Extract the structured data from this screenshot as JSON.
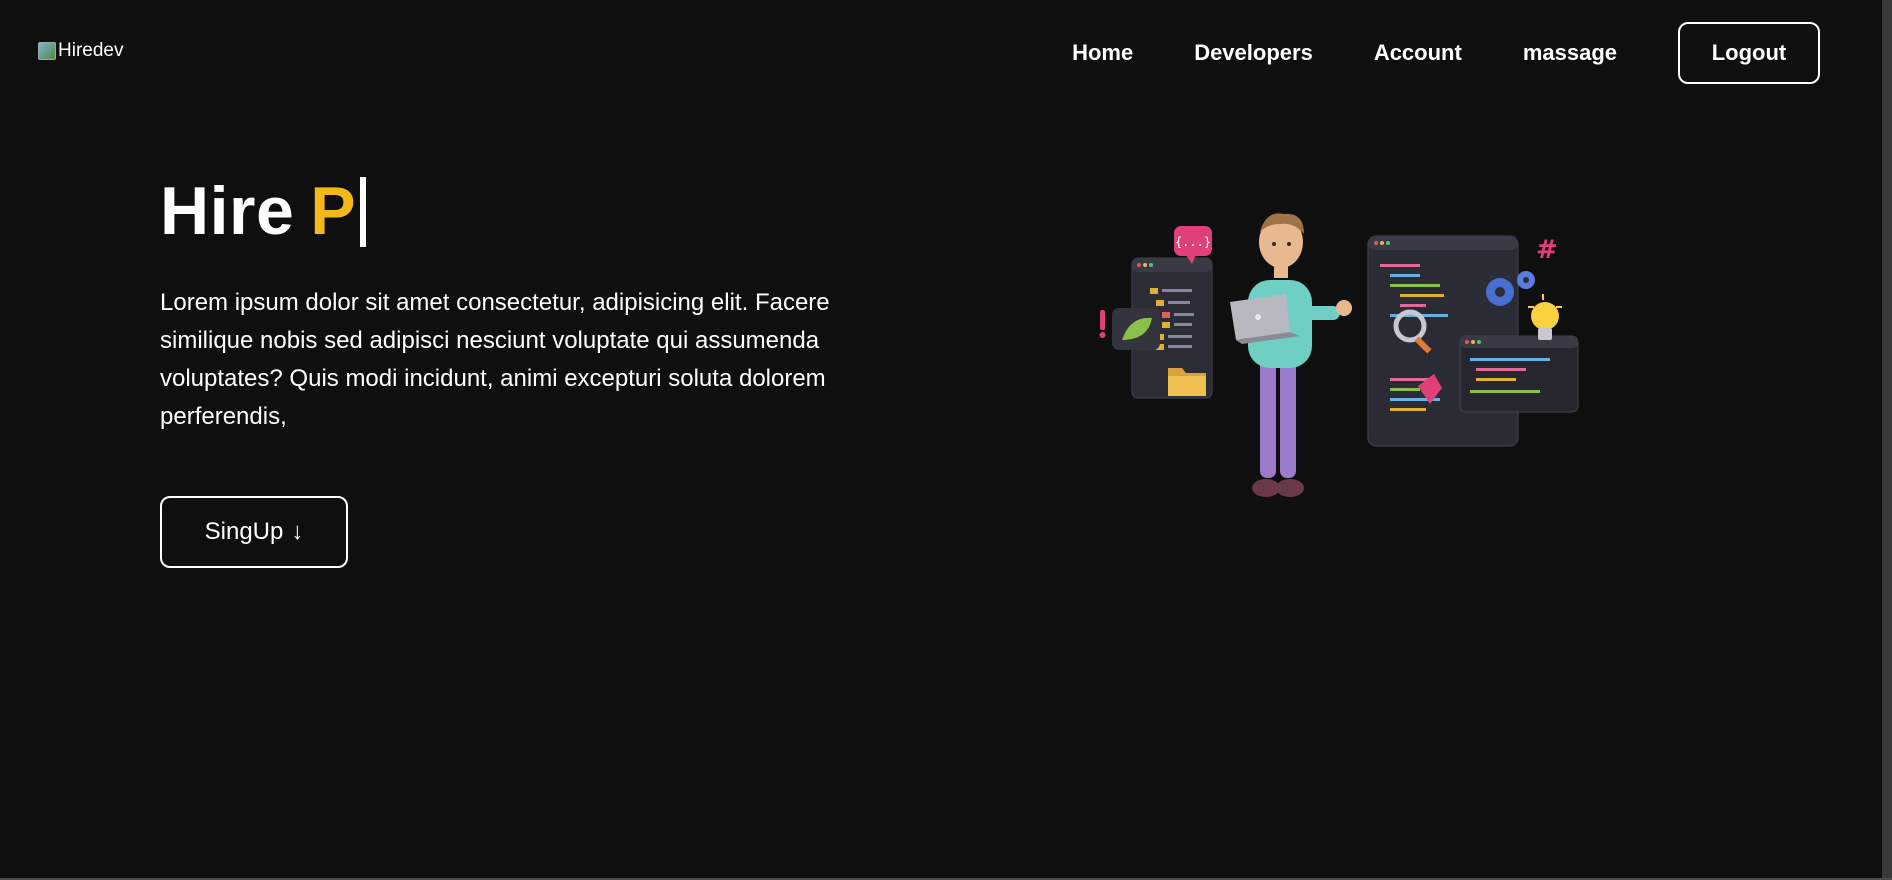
{
  "logo": {
    "alt_text": "Hiredev"
  },
  "nav": {
    "items": [
      "Home",
      "Developers",
      "Account",
      "massage"
    ],
    "logout_label": "Logout"
  },
  "hero": {
    "title_static": "Hire",
    "title_typed": "P",
    "description": "Lorem ipsum dolor sit amet consectetur, adipisicing elit. Facere similique nobis sed adipisci nesciunt voluptate qui assumenda voluptates? Quis modi incidunt, animi excepturi soluta dolorem perferendis,",
    "signup_label": "SingUp",
    "signup_arrow": "↓"
  },
  "colors": {
    "background": "#0f0f0f",
    "accent": "#f0b818",
    "text": "#ffffff"
  },
  "icons": [
    "broken-image-icon",
    "down-arrow-icon",
    "developer-illustration"
  ]
}
